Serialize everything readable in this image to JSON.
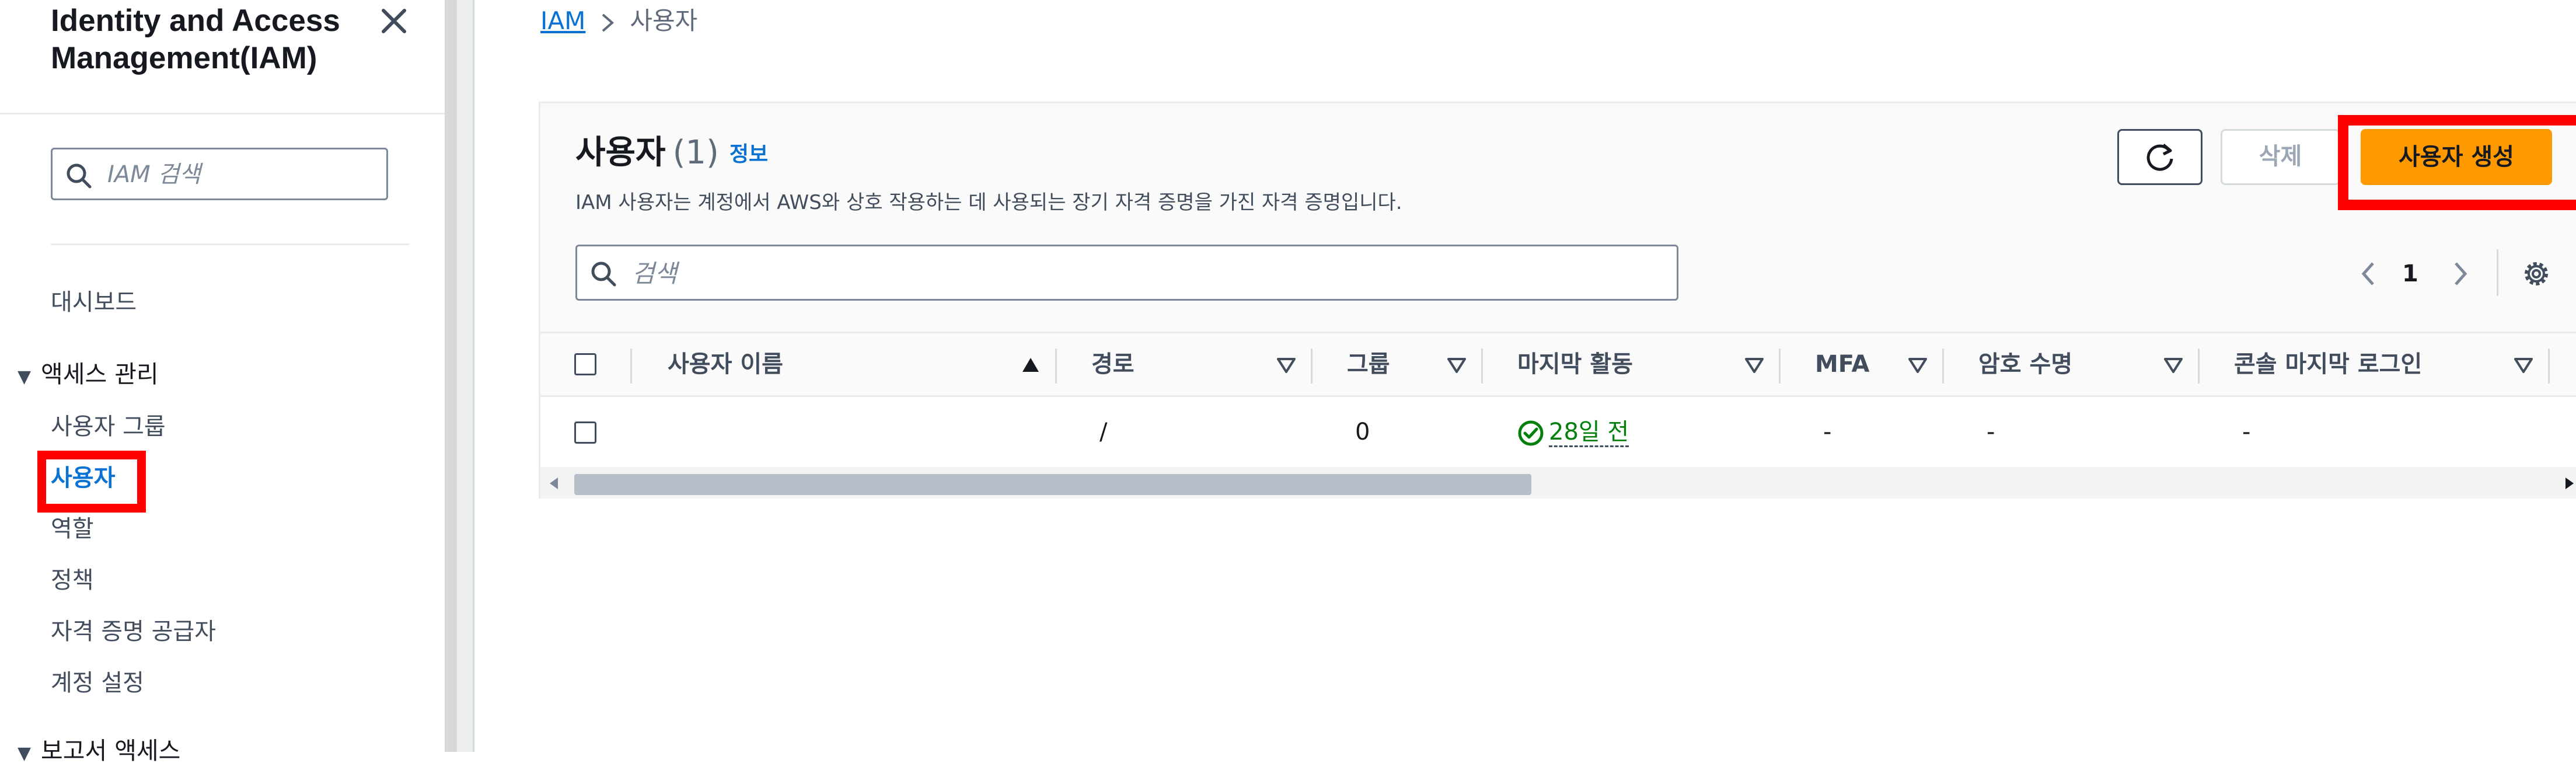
{
  "sidebar": {
    "title": "Identity and Access Management(IAM)",
    "search_placeholder": "IAM 검색",
    "items": {
      "dashboard": "대시보드",
      "access_management": "액세스 관리",
      "user_groups": "사용자 그룹",
      "users": "사용자",
      "roles": "역할",
      "policies": "정책",
      "identity_providers": "자격 증명 공급자",
      "account_settings": "계정 설정",
      "next_section_partial": "보고서 액세스"
    }
  },
  "breadcrumb": {
    "root": "IAM",
    "current": "사용자"
  },
  "users_panel": {
    "title": "사용자",
    "count": "(1)",
    "info_link": "정보",
    "description": "IAM 사용자는 계정에서 AWS와 상호 작용하는 데 사용되는 장기 자격 증명을 가진 자격 증명입니다.",
    "delete_button": "삭제",
    "create_button": "사용자 생성",
    "search_placeholder": "검색",
    "page_number": "1",
    "columns": {
      "user_name": "사용자 이름",
      "path": "경로",
      "group": "그룹",
      "last_activity": "마지막 활동",
      "mfa": "MFA",
      "password_age": "암호 수명",
      "console_last_login": "콘솔 마지막 로그인"
    },
    "rows": [
      {
        "user_name": "",
        "path": "/",
        "group": "0",
        "last_activity": "28일 전",
        "mfa": "-",
        "password_age": "-",
        "console_last_login": "-"
      }
    ]
  },
  "colors": {
    "accent_link": "#0972d3",
    "primary_button": "#ff9900",
    "highlight_box": "#ff0000",
    "success": "#037f0c"
  }
}
